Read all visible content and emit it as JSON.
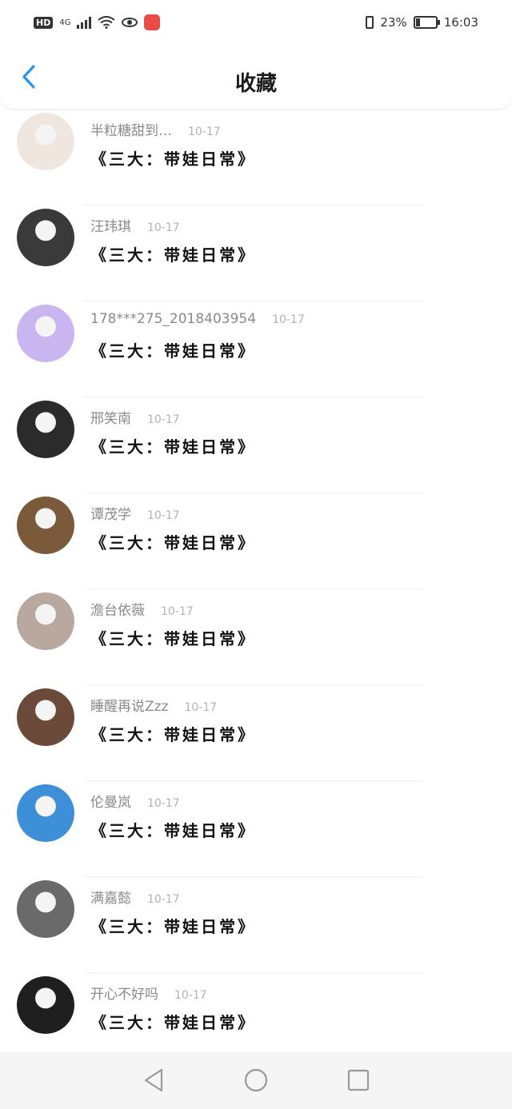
{
  "status_bar": {
    "hd": "HD",
    "network": "4G",
    "battery_percent": "23%",
    "battery_level": 0.23,
    "time": "16:03",
    "icons": [
      "signal-icon",
      "wifi-icon",
      "eye-icon",
      "app-icon",
      "vibrate-icon",
      "battery-icon"
    ]
  },
  "header": {
    "title": "收藏",
    "back_icon": "chevron-left-icon",
    "accent": "#2196F3"
  },
  "favorites": [
    {
      "name": "半粒糖甜到…",
      "date": "10-17",
      "book": "《三大：带娃日常》",
      "avatar_color": "#f0e6e0"
    },
    {
      "name": "汪玮琪",
      "date": "10-17",
      "book": "《三大：带娃日常》",
      "avatar_color": "#3a3a3a"
    },
    {
      "name": "178***275_2018403954",
      "date": "10-17",
      "book": "《三大：带娃日常》",
      "avatar_color": "#c9b6f0"
    },
    {
      "name": "邢笑南",
      "date": "10-17",
      "book": "《三大：带娃日常》",
      "avatar_color": "#2b2b2b"
    },
    {
      "name": "谭茂学",
      "date": "10-17",
      "book": "《三大：带娃日常》",
      "avatar_color": "#7a5a3a"
    },
    {
      "name": "澹台依薇",
      "date": "10-17",
      "book": "《三大：带娃日常》",
      "avatar_color": "#b8a8a0"
    },
    {
      "name": "睡醒再说Zzz",
      "date": "10-17",
      "book": "《三大：带娃日常》",
      "avatar_color": "#6b4a3a"
    },
    {
      "name": "伦曼岚",
      "date": "10-17",
      "book": "《三大：带娃日常》",
      "avatar_color": "#3d8fd8"
    },
    {
      "name": "满嘉懿",
      "date": "10-17",
      "book": "《三大：带娃日常》",
      "avatar_color": "#6a6a6a"
    },
    {
      "name": "开心不好吗",
      "date": "10-17",
      "book": "《三大：带娃日常》",
      "avatar_color": "#1f1f1f"
    }
  ],
  "navbar": {
    "icons": [
      "back-triangle-icon",
      "home-circle-icon",
      "recents-square-icon"
    ]
  }
}
